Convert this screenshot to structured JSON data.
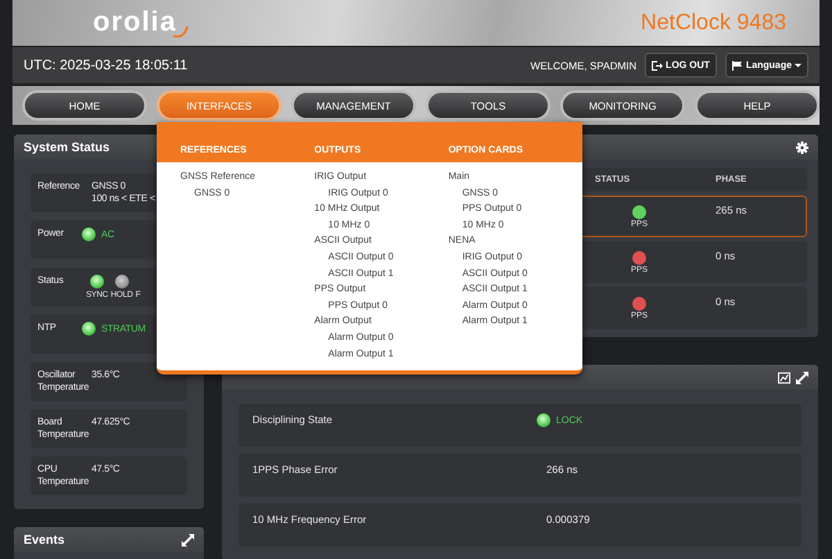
{
  "header": {
    "logo": "orolia",
    "product": "NetClock 9483"
  },
  "top_bar": {
    "utc": "UTC: 2025-03-25 18:05:11",
    "welcome": "WELCOME, SPADMIN",
    "logout": "LOG OUT",
    "language": "Language"
  },
  "nav": [
    {
      "label": "HOME",
      "selected": false
    },
    {
      "label": "INTERFACES",
      "selected": true
    },
    {
      "label": "MANAGEMENT",
      "selected": false
    },
    {
      "label": "TOOLS",
      "selected": false
    },
    {
      "label": "MONITORING",
      "selected": false
    },
    {
      "label": "HELP",
      "selected": false
    }
  ],
  "interfaces_menu": {
    "columns": [
      {
        "heading": "REFERENCES",
        "items": [
          {
            "label": "GNSS Reference",
            "children": [
              {
                "label": "GNSS 0"
              }
            ]
          }
        ]
      },
      {
        "heading": "OUTPUTS",
        "items": [
          {
            "label": "IRIG Output",
            "children": [
              {
                "label": "IRIG Output 0"
              }
            ]
          },
          {
            "label": "10 MHz Output",
            "children": [
              {
                "label": "10 MHz 0"
              }
            ]
          },
          {
            "label": "ASCII Output",
            "children": [
              {
                "label": "ASCII Output 0"
              },
              {
                "label": "ASCII Output 1"
              }
            ]
          },
          {
            "label": "PPS Output",
            "children": [
              {
                "label": "PPS Output 0"
              }
            ]
          },
          {
            "label": "Alarm Output",
            "children": [
              {
                "label": "Alarm Output 0"
              },
              {
                "label": "Alarm Output 1"
              }
            ]
          }
        ]
      },
      {
        "heading": "OPTION CARDS",
        "items": [
          {
            "label": "Main",
            "children": [
              {
                "label": "GNSS 0"
              },
              {
                "label": "PPS Output 0"
              },
              {
                "label": "10 MHz 0"
              }
            ]
          },
          {
            "label": "NENA",
            "children": [
              {
                "label": "IRIG Output 0"
              },
              {
                "label": "ASCII Output 0"
              },
              {
                "label": "ASCII Output 1"
              },
              {
                "label": "Alarm Output 0"
              },
              {
                "label": "Alarm Output 1"
              }
            ]
          }
        ]
      }
    ]
  },
  "system_status": {
    "title": "System Status",
    "rows": [
      {
        "kind": "lines",
        "label": "Reference",
        "lines": [
          "GNSS 0",
          "100 ns < ETE <"
        ]
      },
      {
        "kind": "indicator",
        "label": "Power",
        "on": true,
        "value": "AC"
      },
      {
        "kind": "indicators",
        "label": "Status",
        "indicators": [
          {
            "label": "SYNC",
            "on": true
          },
          {
            "label": "HOLD",
            "on": false
          },
          {
            "label": "F"
          }
        ]
      },
      {
        "kind": "indicator",
        "label": "NTP",
        "on": true,
        "value": "STRATUM"
      },
      {
        "kind": "lines",
        "label": "Oscillator Temperature",
        "lines": [
          "35.6°C"
        ]
      },
      {
        "kind": "lines",
        "label": "Board Temperature",
        "lines": [
          "47.625°C"
        ]
      },
      {
        "kind": "lines",
        "label": "CPU Temperature",
        "lines": [
          "47.5°C"
        ]
      }
    ]
  },
  "references_panel": {
    "columns": [
      "STATUS",
      "PHASE"
    ],
    "rows": [
      {
        "selected": true,
        "color": "#5fd35f",
        "status": "PPS",
        "phase": "265 ns"
      },
      {
        "selected": false,
        "color": "#e05050",
        "status": "PPS",
        "phase": "0 ns"
      },
      {
        "selected": false,
        "color": "#e05050",
        "status": "PPS",
        "phase": "0 ns"
      }
    ]
  },
  "oscillator_panel": {
    "rows": [
      {
        "kind": "indicator",
        "label": "Disciplining State",
        "on": true,
        "value": "LOCK"
      },
      {
        "kind": "text",
        "label": "1PPS Phase Error",
        "value": "266 ns"
      },
      {
        "kind": "text",
        "label": "10 MHz Frequency Error",
        "value": "0.000379"
      }
    ]
  },
  "events_panel": {
    "title": "Events"
  }
}
